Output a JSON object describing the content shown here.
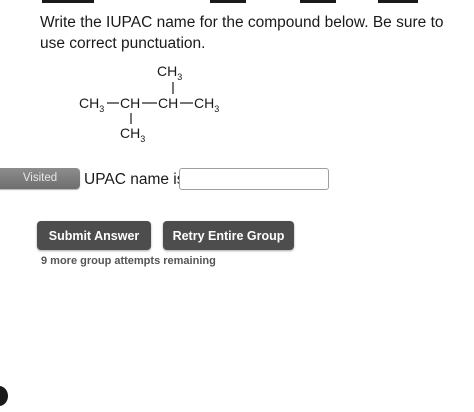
{
  "question": {
    "line1": "Write the IUPAC name for the compound below. Be sure to",
    "line2": "use correct punctuation."
  },
  "structure": {
    "top_substituent": "CH",
    "top_sub": "3",
    "chain": [
      {
        "main": "CH",
        "sub": "3"
      },
      {
        "main": "CH",
        "sub": ""
      },
      {
        "main": "CH",
        "sub": ""
      },
      {
        "main": "CH",
        "sub": "3"
      }
    ],
    "bottom_substituent": "CH",
    "bottom_sub": "3"
  },
  "visited_tag": "Visited",
  "answer": {
    "label": "UPAC name is",
    "value": "",
    "placeholder": ""
  },
  "buttons": {
    "submit": "Submit Answer",
    "retry": "Retry Entire Group"
  },
  "attempts_text": "9 more group attempts remaining",
  "colors": {
    "button_bg": "#4d4d4d",
    "visited_bg": "#7a7a7a",
    "text": "#1a1a1a"
  }
}
